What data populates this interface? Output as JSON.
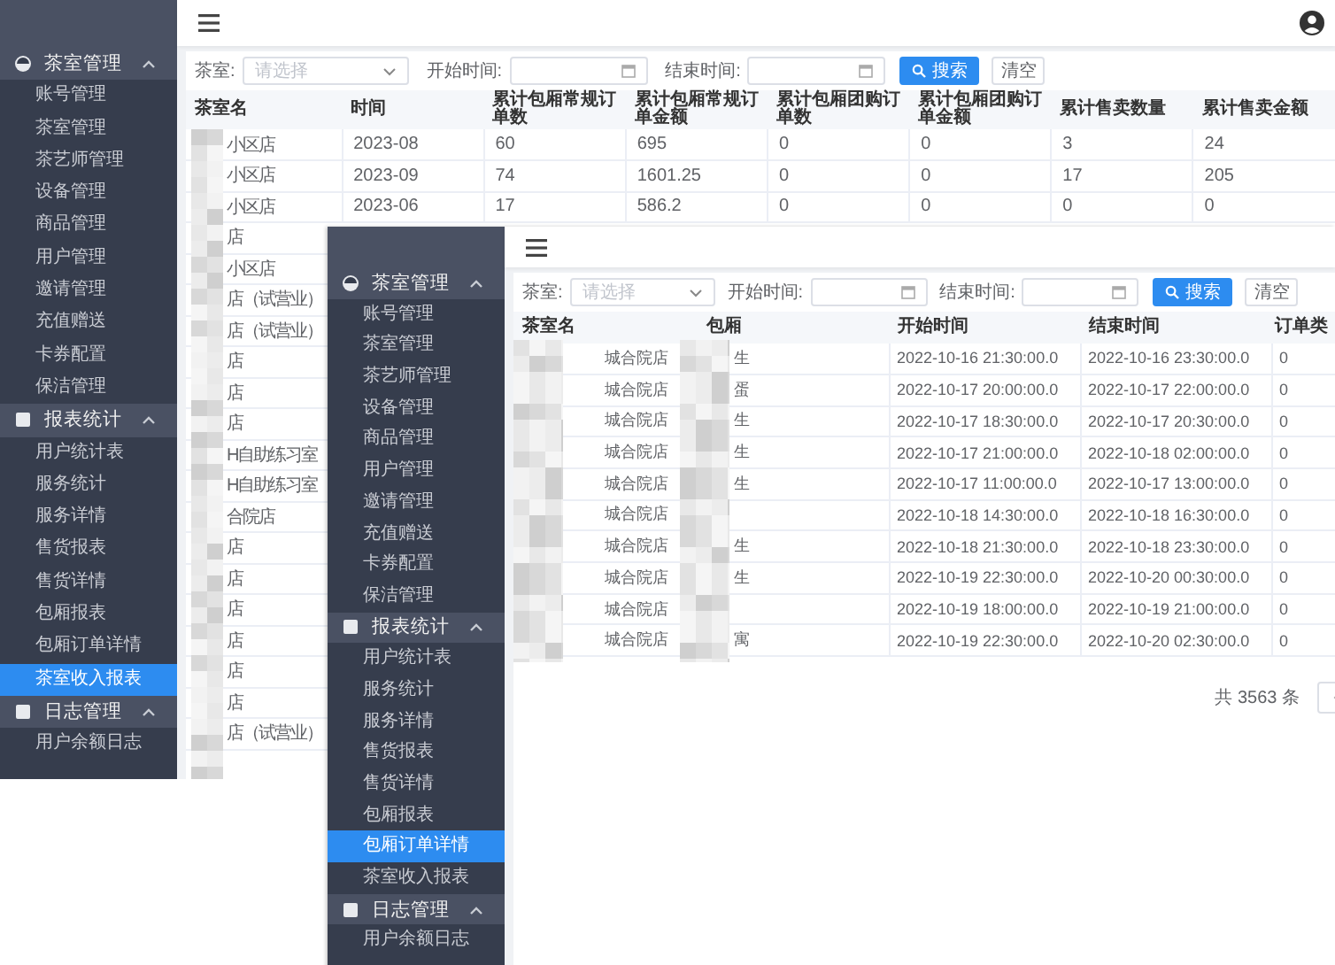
{
  "screens": [
    {
      "sidebar": {
        "groups": [
          {
            "title": "茶室管理",
            "expanded": true,
            "items": [
              {
                "label": "账号管理",
                "selected": false
              },
              {
                "label": "茶室管理",
                "selected": false
              },
              {
                "label": "茶艺师管理",
                "selected": false
              },
              {
                "label": "设备管理",
                "selected": false
              },
              {
                "label": "商品管理",
                "selected": false
              },
              {
                "label": "用户管理",
                "selected": false
              },
              {
                "label": "邀请管理",
                "selected": false
              },
              {
                "label": "充值赠送",
                "selected": false
              },
              {
                "label": "卡券配置",
                "selected": false
              },
              {
                "label": "保洁管理",
                "selected": false
              }
            ]
          },
          {
            "title": "报表统计",
            "expanded": true,
            "items": [
              {
                "label": "用户统计表",
                "selected": false
              },
              {
                "label": "服务统计",
                "selected": false
              },
              {
                "label": "服务详情",
                "selected": false
              },
              {
                "label": "售货报表",
                "selected": false
              },
              {
                "label": "售货详情",
                "selected": false
              },
              {
                "label": "包厢报表",
                "selected": false
              },
              {
                "label": "包厢订单详情",
                "selected": false
              },
              {
                "label": "茶室收入报表",
                "selected": true
              }
            ]
          },
          {
            "title": "日志管理",
            "expanded": true,
            "items": [
              {
                "label": "用户余额日志",
                "selected": false
              }
            ]
          }
        ]
      },
      "show_avatar": true,
      "filters": {
        "room_label": "茶室:",
        "room_placeholder": "请选择",
        "start_label": "开始时间:",
        "end_label": "结束时间:",
        "search_button": "搜索",
        "clear_button": "清空"
      },
      "table": {
        "columns": [
          "茶室名",
          "时间",
          "累计包厢常规订单数",
          "累计包厢常规订单金额",
          "累计包厢团购订单数",
          "累计包厢团购订单金额",
          "累计售卖数量",
          "累计售卖金额"
        ],
        "rows": [
          {
            "cells": [
              "小区店",
              "2023-08",
              "60",
              "695",
              "0",
              "0",
              "3",
              "24"
            ]
          },
          {
            "cells": [
              "小区店",
              "2023-09",
              "74",
              "1601.25",
              "0",
              "0",
              "17",
              "205"
            ]
          },
          {
            "cells": [
              "小区店",
              "2023-06",
              "17",
              "586.2",
              "0",
              "0",
              "0",
              "0"
            ]
          },
          {
            "cells": [
              "店"
            ]
          },
          {
            "cells": [
              "小区店"
            ]
          },
          {
            "cells": [
              "店（试营业）"
            ]
          },
          {
            "cells": [
              "店（试营业）"
            ]
          },
          {
            "cells": [
              "店"
            ]
          },
          {
            "cells": [
              "店"
            ]
          },
          {
            "cells": [
              "店"
            ]
          },
          {
            "cells": [
              "H自助练习室"
            ]
          },
          {
            "cells": [
              "H自助练习室"
            ]
          },
          {
            "cells": [
              "合院店"
            ]
          },
          {
            "cells": [
              "店"
            ]
          },
          {
            "cells": [
              "店"
            ]
          },
          {
            "cells": [
              "店"
            ]
          },
          {
            "cells": [
              "店"
            ]
          },
          {
            "cells": [
              "店"
            ]
          },
          {
            "cells": [
              "店"
            ]
          },
          {
            "cells": [
              "店（试营业）"
            ]
          }
        ]
      }
    },
    {
      "sidebar": {
        "groups": [
          {
            "title": "茶室管理",
            "expanded": true,
            "items": [
              {
                "label": "账号管理",
                "selected": false
              },
              {
                "label": "茶室管理",
                "selected": false
              },
              {
                "label": "茶艺师管理",
                "selected": false
              },
              {
                "label": "设备管理",
                "selected": false
              },
              {
                "label": "商品管理",
                "selected": false
              },
              {
                "label": "用户管理",
                "selected": false
              },
              {
                "label": "邀请管理",
                "selected": false
              },
              {
                "label": "充值赠送",
                "selected": false
              },
              {
                "label": "卡券配置",
                "selected": false
              },
              {
                "label": "保洁管理",
                "selected": false
              }
            ]
          },
          {
            "title": "报表统计",
            "expanded": true,
            "items": [
              {
                "label": "用户统计表",
                "selected": false
              },
              {
                "label": "服务统计",
                "selected": false
              },
              {
                "label": "服务详情",
                "selected": false
              },
              {
                "label": "售货报表",
                "selected": false
              },
              {
                "label": "售货详情",
                "selected": false
              },
              {
                "label": "包厢报表",
                "selected": false
              },
              {
                "label": "包厢订单详情",
                "selected": true
              },
              {
                "label": "茶室收入报表",
                "selected": false
              }
            ]
          },
          {
            "title": "日志管理",
            "expanded": true,
            "items": [
              {
                "label": "用户余额日志",
                "selected": false
              }
            ]
          }
        ]
      },
      "filters": {
        "room_label": "茶室:",
        "room_placeholder": "请选择",
        "start_label": "开始时间:",
        "end_label": "结束时间:",
        "search_button": "搜索",
        "clear_button": "清空"
      },
      "table": {
        "columns": [
          "茶室名",
          "包厢",
          "开始时间",
          "结束时间",
          "订单类"
        ],
        "rows": [
          {
            "cells": [
              "城合院店",
              "生",
              "2022-10-16 21:30:00.0",
              "2022-10-16 23:30:00.0",
              "0"
            ]
          },
          {
            "cells": [
              "城合院店",
              "蛋",
              "2022-10-17 20:00:00.0",
              "2022-10-17 22:00:00.0",
              "0"
            ]
          },
          {
            "cells": [
              "城合院店",
              "生",
              "2022-10-17 18:30:00.0",
              "2022-10-17 20:30:00.0",
              "0"
            ]
          },
          {
            "cells": [
              "城合院店",
              "生",
              "2022-10-17 21:00:00.0",
              "2022-10-18 02:00:00.0",
              "0"
            ]
          },
          {
            "cells": [
              "城合院店",
              "生",
              "2022-10-17 11:00:00.0",
              "2022-10-17 13:00:00.0",
              "0"
            ]
          },
          {
            "cells": [
              "城合院店",
              null,
              "2022-10-18 14:30:00.0",
              "2022-10-18 16:30:00.0",
              "0"
            ]
          },
          {
            "cells": [
              "城合院店",
              "生",
              "2022-10-18 21:30:00.0",
              "2022-10-18 23:30:00.0",
              "0"
            ]
          },
          {
            "cells": [
              "城合院店",
              "生",
              "2022-10-19 22:30:00.0",
              "2022-10-20 00:30:00.0",
              "0"
            ]
          },
          {
            "cells": [
              "城合院店",
              null,
              "2022-10-19 18:00:00.0",
              "2022-10-19 21:00:00.0",
              "0"
            ]
          },
          {
            "cells": [
              "城合院店",
              "寓",
              "2022-10-19 22:30:00.0",
              "2022-10-20 02:30:00.0",
              "0"
            ]
          }
        ]
      },
      "pagination": {
        "total": "共 3563 条"
      }
    }
  ]
}
